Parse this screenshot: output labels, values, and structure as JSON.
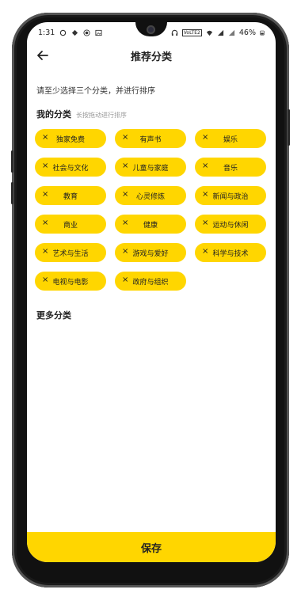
{
  "status": {
    "time": "1:31",
    "battery": "46%",
    "volte": "VoLTE2"
  },
  "appbar": {
    "title": "推荐分类"
  },
  "instruction": "请至少选择三个分类，并进行排序",
  "my_section": {
    "title": "我的分类",
    "subtitle": "长按拖动进行排序"
  },
  "chips": [
    {
      "label": "独家免费"
    },
    {
      "label": "有声书"
    },
    {
      "label": "娱乐"
    },
    {
      "label": "社会与文化"
    },
    {
      "label": "儿童与家庭"
    },
    {
      "label": "音乐"
    },
    {
      "label": "教育"
    },
    {
      "label": "心灵修炼"
    },
    {
      "label": "新闻与政治"
    },
    {
      "label": "商业"
    },
    {
      "label": "健康"
    },
    {
      "label": "运动与休闲"
    },
    {
      "label": "艺术与生活"
    },
    {
      "label": "游戏与爱好"
    },
    {
      "label": "科学与技术"
    },
    {
      "label": "电视与电影"
    },
    {
      "label": "政府与组织"
    }
  ],
  "remove_glyph": "×",
  "more_section": {
    "title": "更多分类"
  },
  "save_label": "保存",
  "colors": {
    "accent": "#FFD600"
  }
}
